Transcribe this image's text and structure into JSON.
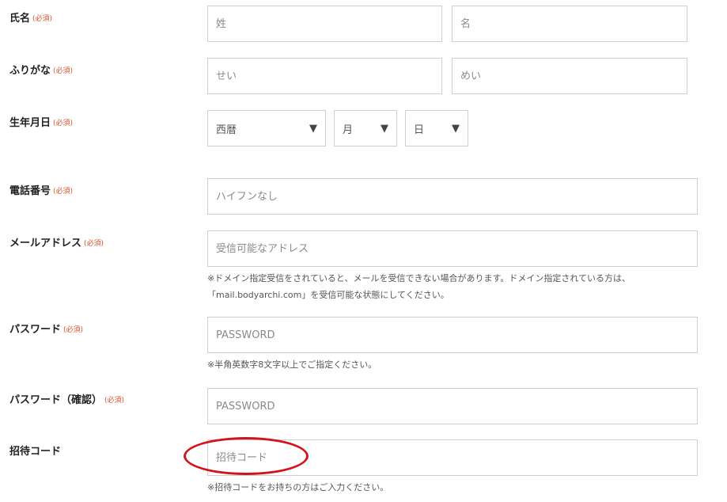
{
  "required_badge": "(必須)",
  "name": {
    "label": "氏名",
    "last_placeholder": "姓",
    "first_placeholder": "名"
  },
  "furigana": {
    "label": "ふりがな",
    "last_placeholder": "せい",
    "first_placeholder": "めい"
  },
  "birthdate": {
    "label": "生年月日",
    "year_value": "西暦",
    "month_value": "月",
    "day_value": "日"
  },
  "phone": {
    "label": "電話番号",
    "placeholder": "ハイフンなし"
  },
  "email": {
    "label": "メールアドレス",
    "placeholder": "受信可能なアドレス",
    "note_line1": "※ドメイン指定受信をされていると、メールを受信できない場合があります。ドメイン指定されている方は、",
    "note_line2": "「mail.bodyarchi.com」を受信可能な状態にしてください。"
  },
  "password": {
    "label": "パスワード",
    "placeholder": "PASSWORD",
    "note": "※半角英数字8文字以上でご指定ください。"
  },
  "password_confirm": {
    "label": "パスワード（確認）",
    "placeholder": "PASSWORD"
  },
  "invite": {
    "label": "招待コード",
    "placeholder": "招待コード",
    "note": "※招待コードをお持ちの方はご入力ください。"
  },
  "icons": {
    "dropdown": "▼"
  },
  "colors": {
    "required": "#d9502e",
    "highlight": "#d3131b",
    "border": "#cfcfcf"
  }
}
